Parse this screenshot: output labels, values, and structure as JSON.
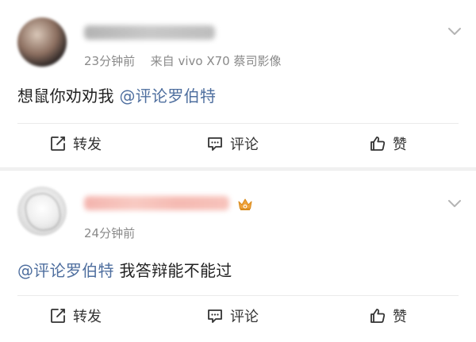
{
  "posts": [
    {
      "meta_time": "23分钟前",
      "meta_source": "来自",
      "meta_device": "vivo X70 蔡司影像",
      "content_text": "想鼠你劝劝我",
      "content_mention": "@评论罗伯特",
      "actions": {
        "repost_label": "转发",
        "comment_label": "评论",
        "like_label": "赞"
      }
    },
    {
      "meta_time": "24分钟前",
      "content_mention": "@评论罗伯特",
      "content_text": " 我答辩能不能过",
      "actions": {
        "repost_label": "转发",
        "comment_label": "评论",
        "like_label": "赞"
      }
    }
  ],
  "icons": {
    "more": "chevron-down-icon",
    "repost": "repost-icon",
    "comment": "comment-icon",
    "like": "thumbs-up-icon",
    "badge": "crown-icon"
  },
  "colors": {
    "mention": "#4f6f9f",
    "meta": "#8a8a8a",
    "text": "#222222",
    "badge": "#f0a33b"
  }
}
